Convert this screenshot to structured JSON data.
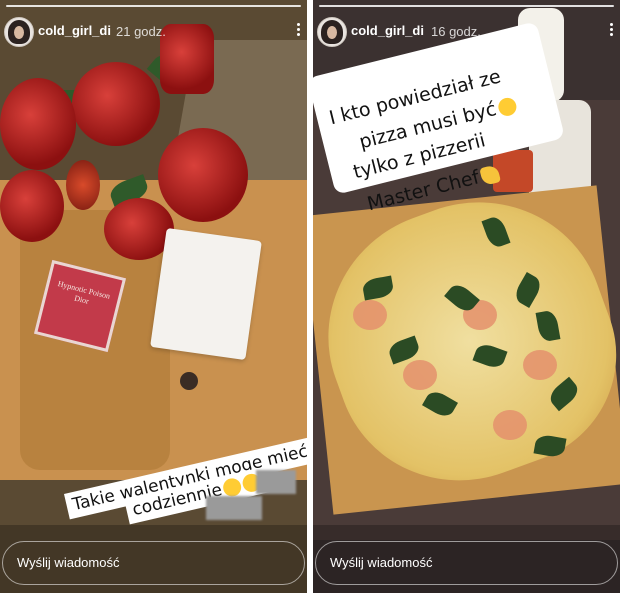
{
  "stories": [
    {
      "username": "cold_girl_di",
      "time": "21 godz.",
      "caption_lines": [
        "Takie walentynki mogę mieć",
        "codziennie"
      ],
      "caption_emoji": [
        "heart-eyes-emoji",
        "heart-eyes-emoji"
      ],
      "perfume_text": "Hypnotic Poison Dior",
      "reply_placeholder": "Wyślij wiadomość",
      "menu_icon": "more-vertical-icon"
    },
    {
      "username": "cold_girl_di",
      "time": "16 godz.",
      "sticker_lines": [
        "I kto powiedział ze",
        "pizza musi być",
        "tylko z pizzerii",
        "Master Chef"
      ],
      "sticker_emoji": [
        "smiling-face-emoji",
        "flexed-biceps-emoji"
      ],
      "reply_placeholder": "Wyślij wiadomość",
      "menu_icon": "more-vertical-icon"
    }
  ],
  "colors": {
    "text": "#ffffff",
    "caption_bg": "#ffffff",
    "caption_text": "#111111"
  }
}
